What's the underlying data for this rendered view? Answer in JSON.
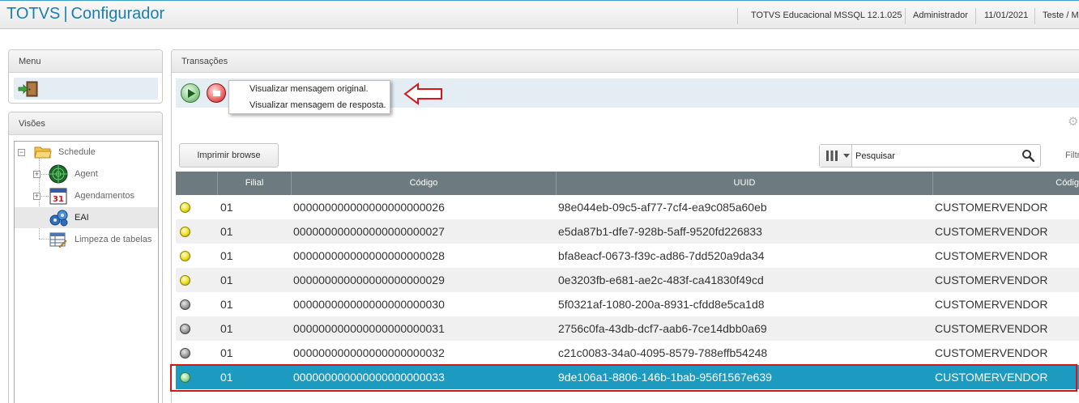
{
  "header": {
    "app_name": "TOTVS",
    "separator": "|",
    "app_module": "Configurador",
    "product": "TOTVS Educacional MSSQL 12.1.025",
    "user": "Administrador",
    "date": "11/01/2021",
    "environment": "Teste / M"
  },
  "menu_panel": {
    "title": "Menu",
    "exit_icon": "exit-door-icon"
  },
  "visoes_panel": {
    "title": "Visões",
    "tree": [
      {
        "label": "Schedule",
        "icon": "folder-icon"
      },
      {
        "label": "Agent",
        "icon": "globe-radar-icon"
      },
      {
        "label": "Agendamentos",
        "icon": "calendar-icon",
        "icon_text": "31"
      },
      {
        "label": "EAI",
        "icon": "puzzle-icon"
      },
      {
        "label": "Limpeza de tabelas",
        "icon": "table-clean-icon"
      }
    ]
  },
  "transactions_panel": {
    "title": "Transações",
    "popup_menu": [
      "Visualizar mensagem original.",
      "Visualizar mensagem de resposta."
    ],
    "print_button": "Imprimir browse",
    "search_placeholder": "Pesquisar",
    "filter_label": "Filtr"
  },
  "colors": {
    "accent": "#1a7fb0",
    "selected_row": "#1c9ac0",
    "header_gray": "#6d7b81",
    "highlight_red": "#d7151a"
  },
  "table": {
    "columns": [
      "",
      "Filial",
      "Código",
      "UUID",
      "Códig"
    ],
    "rows": [
      {
        "status": "yellow",
        "filial": "01",
        "codigo": "000000000000000000000026",
        "uuid": "98e044eb-09c5-af77-7cf4-ea9c085a60eb",
        "codigo2": "CUSTOMERVENDOR"
      },
      {
        "status": "yellow",
        "filial": "01",
        "codigo": "000000000000000000000027",
        "uuid": "e5da87b1-dfe7-928b-5aff-9520fd226833",
        "codigo2": "CUSTOMERVENDOR"
      },
      {
        "status": "yellow",
        "filial": "01",
        "codigo": "000000000000000000000028",
        "uuid": "bfa8eacf-0673-f39c-ad86-7dd520a9da34",
        "codigo2": "CUSTOMERVENDOR"
      },
      {
        "status": "yellow",
        "filial": "01",
        "codigo": "000000000000000000000029",
        "uuid": "0e3203fb-e681-ae2c-483f-ca41830f49cd",
        "codigo2": "CUSTOMERVENDOR"
      },
      {
        "status": "gray",
        "filial": "01",
        "codigo": "000000000000000000000030",
        "uuid": "5f0321af-1080-200a-8931-cfdd8e5ca1d8",
        "codigo2": "CUSTOMERVENDOR"
      },
      {
        "status": "gray",
        "filial": "01",
        "codigo": "000000000000000000000031",
        "uuid": "2756c0fa-43db-dcf7-aab6-7ce14dbb0a69",
        "codigo2": "CUSTOMERVENDOR"
      },
      {
        "status": "gray",
        "filial": "01",
        "codigo": "000000000000000000000032",
        "uuid": "c21c0083-34a0-4095-8579-788effb54248",
        "codigo2": "CUSTOMERVENDOR"
      },
      {
        "status": "green",
        "filial": "01",
        "codigo": "000000000000000000000033",
        "uuid": "9de106a1-8806-146b-1bab-956f1567e639",
        "codigo2": "CUSTOMERVENDOR",
        "selected": true
      }
    ]
  }
}
